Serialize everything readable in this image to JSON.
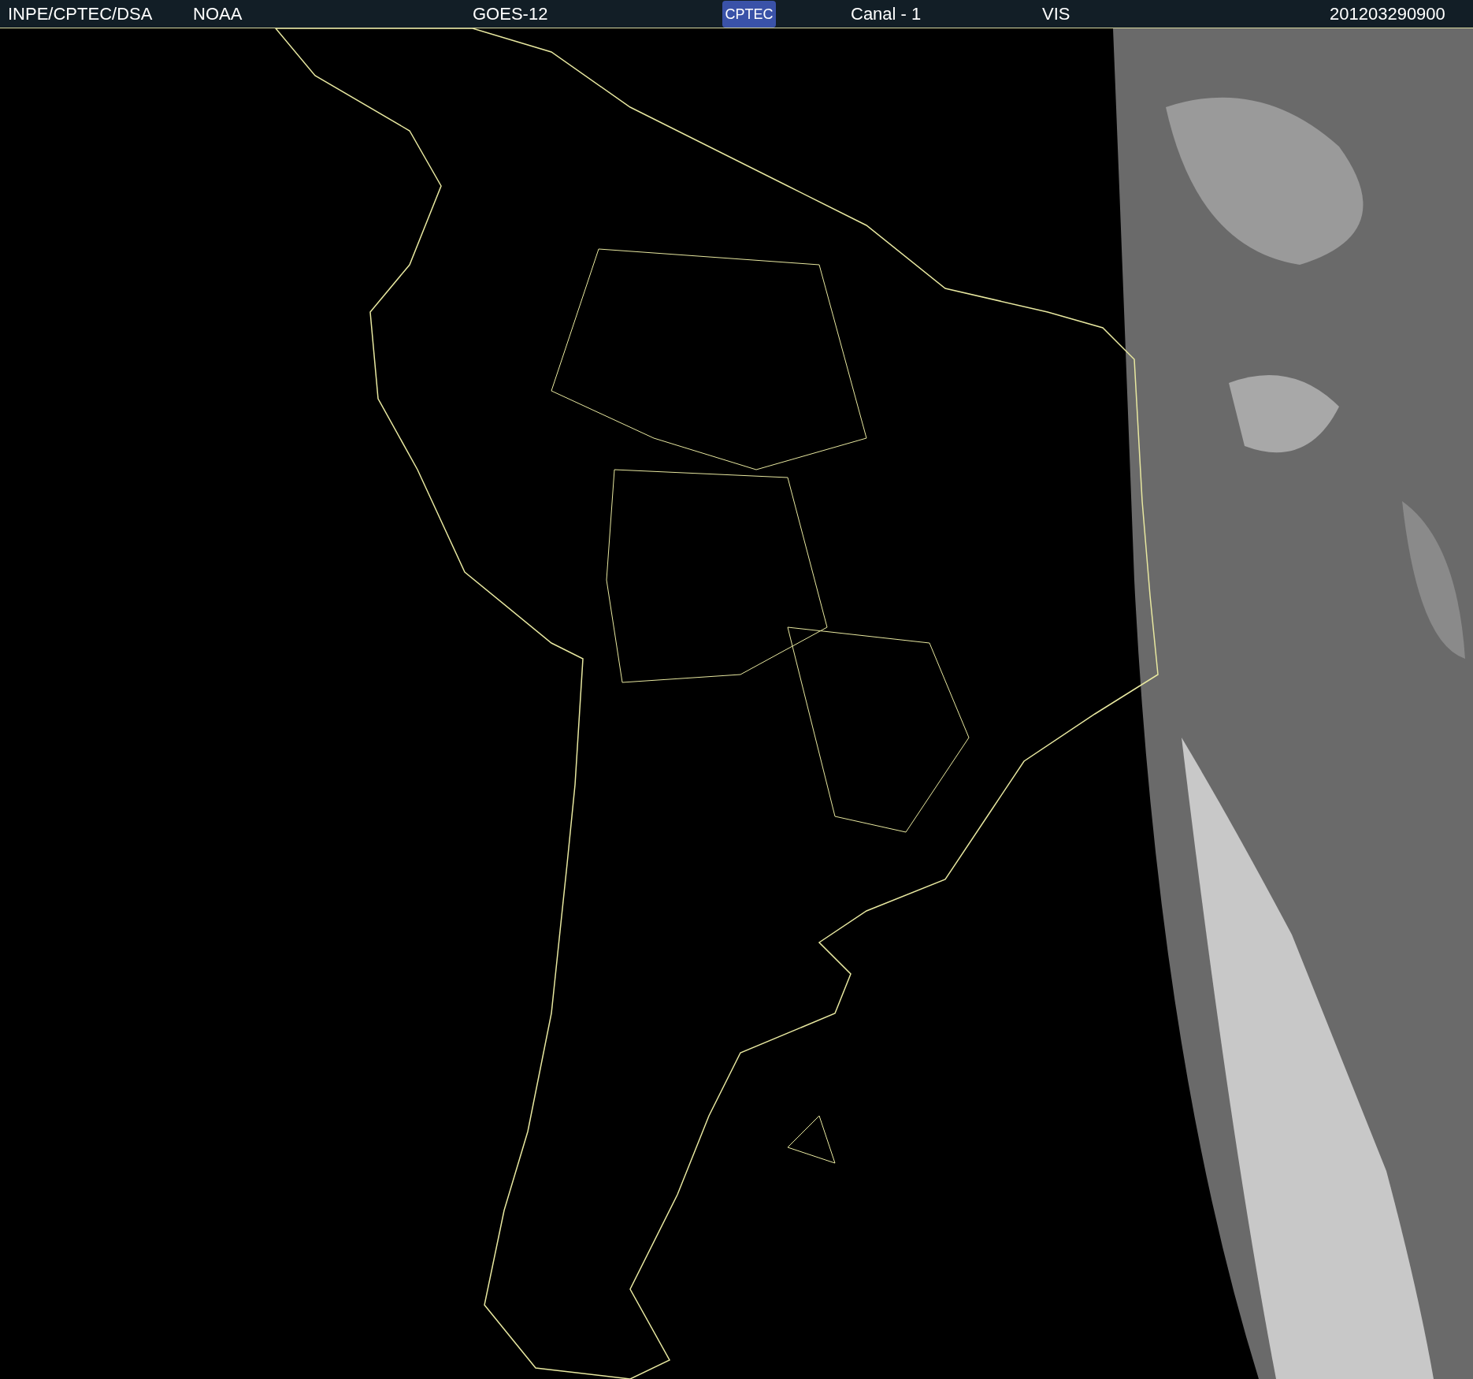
{
  "header": {
    "source": "INPE/CPTEC/DSA",
    "agency": "NOAA",
    "satellite": "GOES-12",
    "logo_text": "CPTEC",
    "channel": "Canal - 1",
    "band": "VIS",
    "timestamp": "201203290900"
  }
}
